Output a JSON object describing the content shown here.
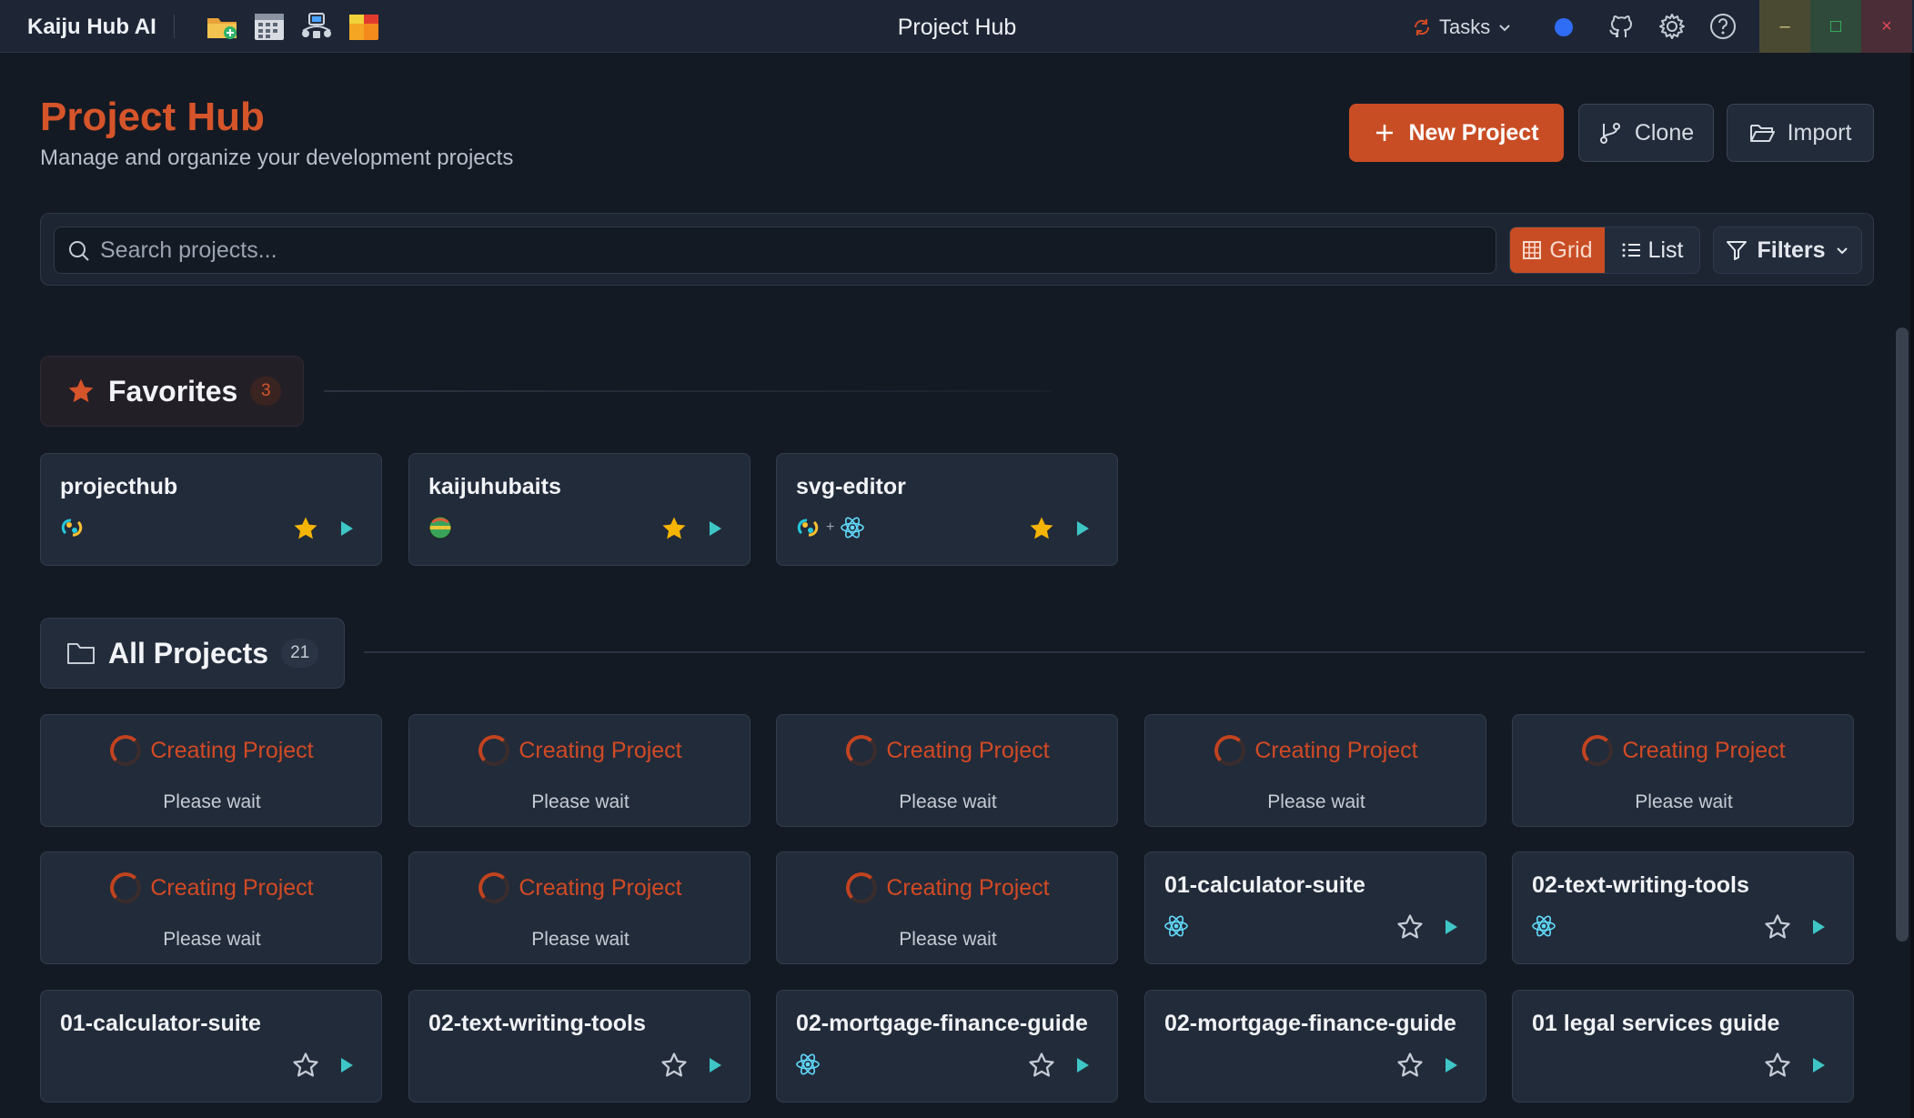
{
  "titlebar": {
    "app_name": "Kaiju Hub AI",
    "window_title": "Project Hub",
    "tasks_label": "Tasks",
    "minimize_glyph": "–",
    "maximize_glyph": "□",
    "close_glyph": "×",
    "quick_icons": [
      "open-folder-icon",
      "calendar-icon",
      "network-icon",
      "color-palette-icon"
    ],
    "right_icons": [
      "status-dot-icon",
      "github-icon",
      "gear-icon",
      "help-icon"
    ]
  },
  "header": {
    "title": "Project Hub",
    "subtitle": "Manage and organize your development projects",
    "new_project_label": "New Project",
    "clone_label": "Clone",
    "import_label": "Import"
  },
  "toolbar": {
    "search_placeholder": "Search projects...",
    "search_value": "",
    "grid_label": "Grid",
    "list_label": "List",
    "filters_label": "Filters",
    "active_view": "Grid"
  },
  "favorites": {
    "title": "Favorites",
    "count": "3",
    "projects": [
      {
        "name": "projecthub",
        "tech": [
          "tauri-icon"
        ],
        "favorite": true
      },
      {
        "name": "kaijuhubaits",
        "tech": [
          "globe-icon"
        ],
        "favorite": true
      },
      {
        "name": "svg-editor",
        "tech": [
          "tauri-icon",
          "react-icon"
        ],
        "joiner": "+",
        "favorite": true
      }
    ]
  },
  "all_projects": {
    "title": "All Projects",
    "count": "21",
    "loading": {
      "title": "Creating Project",
      "subtitle": "Please wait"
    },
    "loading_count": 8,
    "projects": [
      {
        "name": "01-calculator-suite",
        "tech": [
          "react-icon"
        ],
        "favorite": false
      },
      {
        "name": "02-text-writing-tools",
        "tech": [
          "react-icon"
        ],
        "favorite": false
      },
      {
        "name": "01-calculator-suite",
        "tech": [],
        "favorite": false
      },
      {
        "name": "02-text-writing-tools",
        "tech": [],
        "favorite": false
      },
      {
        "name": "02-mortgage-finance-guide",
        "tech": [
          "react-icon"
        ],
        "favorite": false
      },
      {
        "name": "02-mortgage-finance-guide",
        "tech": [],
        "favorite": false
      },
      {
        "name": "01 legal services guide",
        "tech": [],
        "favorite": false
      }
    ]
  },
  "colors": {
    "accent": "#c94d24",
    "title_orange": "#d5542a",
    "favorite_star": "#f5b400",
    "play_teal": "#3ec6c6",
    "react_blue": "#61dafb",
    "status_dot": "#2f6df6"
  }
}
